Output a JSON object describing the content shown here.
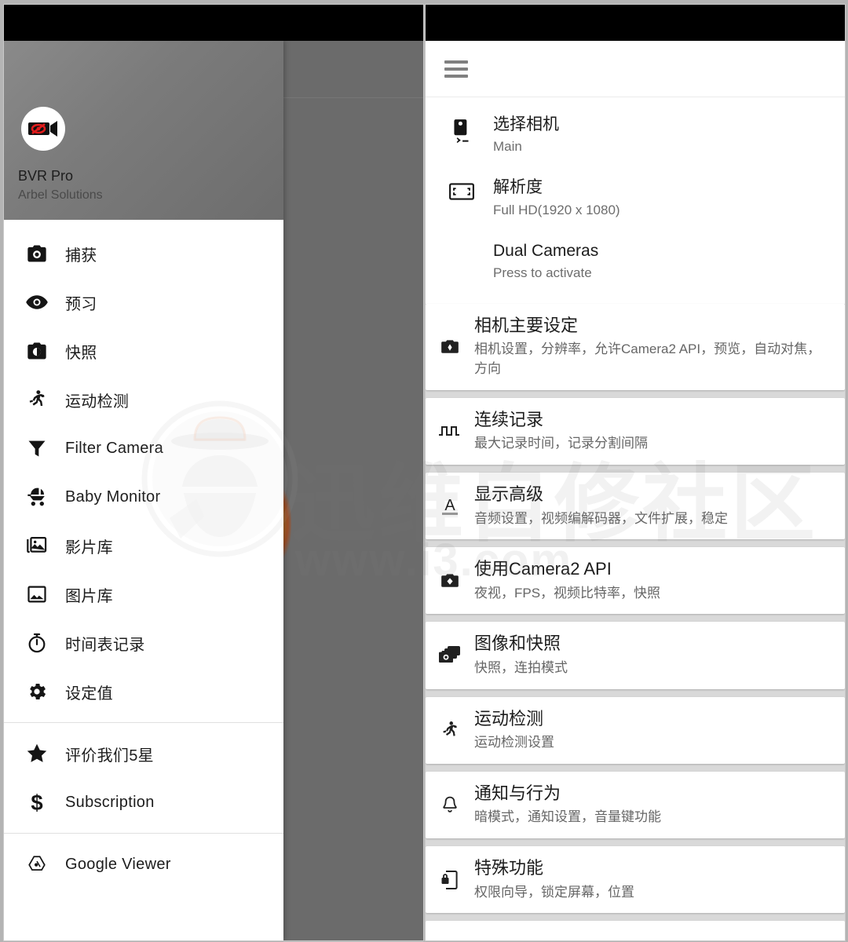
{
  "left_panel": {
    "drawer": {
      "app_icon": "video-camera-eye-off-icon",
      "app_name": "BVR Pro",
      "app_vendor": "Arbel Solutions",
      "groups": [
        {
          "items": [
            {
              "icon": "camera-icon",
              "label": "捕获"
            },
            {
              "icon": "eye-icon",
              "label": "预习"
            },
            {
              "icon": "snapshot-icon",
              "label": "快照"
            },
            {
              "icon": "running-person-icon",
              "label": "运动检测"
            },
            {
              "icon": "filter-icon",
              "label": "Filter Camera"
            },
            {
              "icon": "stroller-icon",
              "label": "Baby Monitor"
            },
            {
              "icon": "video-library-icon",
              "label": "影片库"
            },
            {
              "icon": "photo-library-icon",
              "label": "图片库"
            },
            {
              "icon": "stopwatch-icon",
              "label": "时间表记录"
            },
            {
              "icon": "gear-icon",
              "label": "设定值"
            }
          ]
        },
        {
          "items": [
            {
              "icon": "star-icon",
              "label": "评价我们5星"
            },
            {
              "icon": "dollar-icon",
              "label": "Subscription"
            }
          ]
        },
        {
          "items": [
            {
              "icon": "google-drive-icon",
              "label": "Google Viewer"
            }
          ]
        }
      ]
    }
  },
  "right_panel": {
    "app_bar": {
      "menu_icon": "hamburger-menu-icon"
    },
    "plain_rows": [
      {
        "icon": "camera-switch-icon",
        "title": "选择相机",
        "subtitle": "Main"
      },
      {
        "icon": "resolution-icon",
        "title": "解析度",
        "subtitle": "Full HD(1920 x 1080)"
      },
      {
        "icon": "",
        "title": "Dual Cameras",
        "subtitle": "Press to activate"
      }
    ],
    "cards": [
      {
        "icon": "camera-settings-icon",
        "title": "相机主要设定",
        "subtitle": "相机设置，分辨率，允许Camera2 API，预览，自动对焦，方向"
      },
      {
        "icon": "pulse-wave-icon",
        "title": "连续记录",
        "subtitle": "最大记录时间，记录分割间隔"
      },
      {
        "icon": "text-format-icon",
        "title": "显示高级",
        "subtitle": "音频设置，视频编解码器，文件扩展，稳定"
      },
      {
        "icon": "camera2-api-icon",
        "title": "使用Camera2 API",
        "subtitle": "夜视，FPS，视频比特率，快照"
      },
      {
        "icon": "burst-photo-icon",
        "title": "图像和快照",
        "subtitle": "快照，连拍模式"
      },
      {
        "icon": "running-person-icon",
        "title": "运动检测",
        "subtitle": "运动检测设置"
      },
      {
        "icon": "bell-icon",
        "title": "通知与行为",
        "subtitle": "暗模式，通知设置，音量键功能"
      },
      {
        "icon": "phone-lock-icon",
        "title": "特殊功能",
        "subtitle": "权限向导，锁定屏幕，位置"
      }
    ]
  },
  "watermark": {
    "text": "迅维自修社区",
    "url": "www.i3.com"
  },
  "colors": {
    "accent_red": "#e01b1b",
    "status_bar": "#000000",
    "scrim": "#6b6b6b",
    "page_background": "#d9d9d9",
    "card_background": "#ffffff",
    "primary_text": "#1c1c1c",
    "secondary_text": "#6d6d6d"
  }
}
